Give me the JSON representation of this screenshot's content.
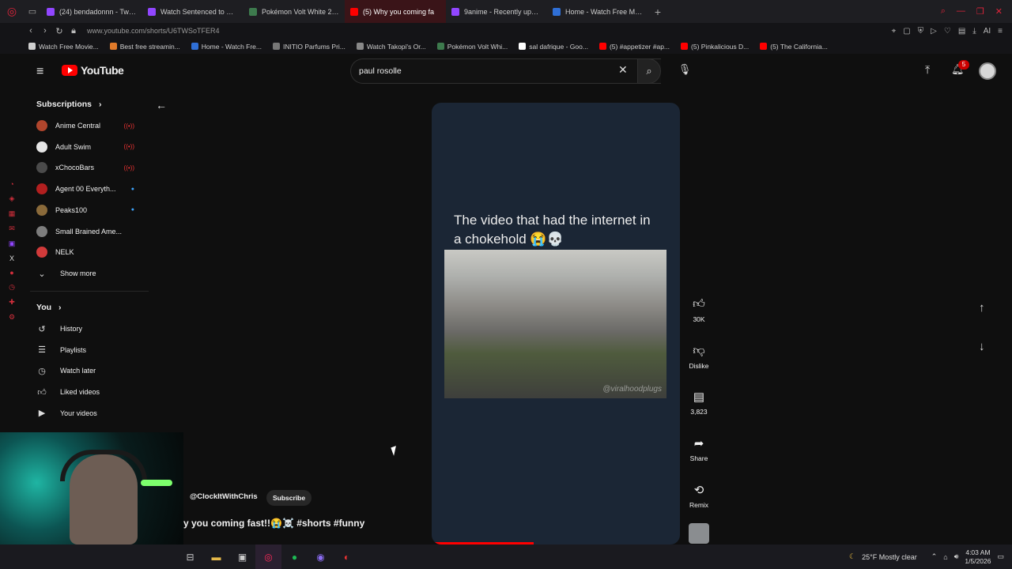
{
  "browser": {
    "tabs": [
      {
        "label": "(24) bendadonnn - Twitch",
        "color": "#9146ff",
        "active": false
      },
      {
        "label": "Watch Sentenced to Be a",
        "color": "#9146ff",
        "active": false
      },
      {
        "label": "Pokémon Volt White 2 Re",
        "color": "#3d7a4d",
        "active": false
      },
      {
        "label": "(5) Why you coming fa",
        "color": "#ff0000",
        "active": true
      },
      {
        "label": "9anime - Recently update",
        "color": "#9146ff",
        "active": false
      },
      {
        "label": "Home - Watch Free Movie",
        "color": "#2f6fd6",
        "active": false
      }
    ],
    "url": "www.youtube.com/shorts/U6TWSoTFER4",
    "bookmarks": [
      {
        "label": "Watch Free Movie...",
        "color": "#d0d0d0"
      },
      {
        "label": "Best free streamin...",
        "color": "#e07a2a"
      },
      {
        "label": "Home - Watch Fre...",
        "color": "#2f6fd6"
      },
      {
        "label": "INITIO Parfums Pri...",
        "color": "#777777"
      },
      {
        "label": "Watch Takopi's Or...",
        "color": "#888888"
      },
      {
        "label": "Pokémon Volt Whi...",
        "color": "#3d7a4d"
      },
      {
        "label": "sal dafrique - Goo...",
        "color": "#ffffff"
      },
      {
        "label": "(5) #appetizer #ap...",
        "color": "#ff0000"
      },
      {
        "label": "(5) Pinkalicious D...",
        "color": "#ff0000"
      },
      {
        "label": "(5) The California...",
        "color": "#ff0000"
      }
    ]
  },
  "header": {
    "logo_text": "YouTube",
    "search_value": "paul rosolle",
    "notification_count": "5"
  },
  "sidebar": {
    "subscriptions_label": "Subscriptions",
    "channels": [
      {
        "name": "Anime Central",
        "status": "live",
        "color": "#b0452c"
      },
      {
        "name": "Adult Swim",
        "status": "live",
        "color": "#e6e6e6"
      },
      {
        "name": "xChocoBars",
        "status": "live",
        "color": "#4b4b4b"
      },
      {
        "name": "Agent 00 Everyth...",
        "status": "new",
        "color": "#b21f1f"
      },
      {
        "name": "Peaks100",
        "status": "new",
        "color": "#8a6a3a"
      },
      {
        "name": "Small Brained Ame...",
        "status": "none",
        "color": "#7d7d7d"
      },
      {
        "name": "NELK",
        "status": "none",
        "color": "#d13a3a"
      }
    ],
    "show_more": "Show more",
    "you_label": "You",
    "you_items": [
      "History",
      "Playlists",
      "Watch later",
      "Liked videos",
      "Your videos"
    ]
  },
  "short": {
    "caption": "The video that had the internet in a chokehold 😭💀",
    "watermark": "@viralhoodplugs",
    "progress": 0.41,
    "channel": "@ClockItWithChris",
    "subscribe_label": "Subscribe",
    "title": "y you coming fast!!😭☠️ #shorts #funny"
  },
  "actions": {
    "likes": "30K",
    "dislike_label": "Dislike",
    "comments": "3,823",
    "share_label": "Share",
    "remix_label": "Remix"
  },
  "taskbar": {
    "weather": "25°F  Mostly clear",
    "time": "4:03 AM",
    "date": "1/5/2026"
  }
}
